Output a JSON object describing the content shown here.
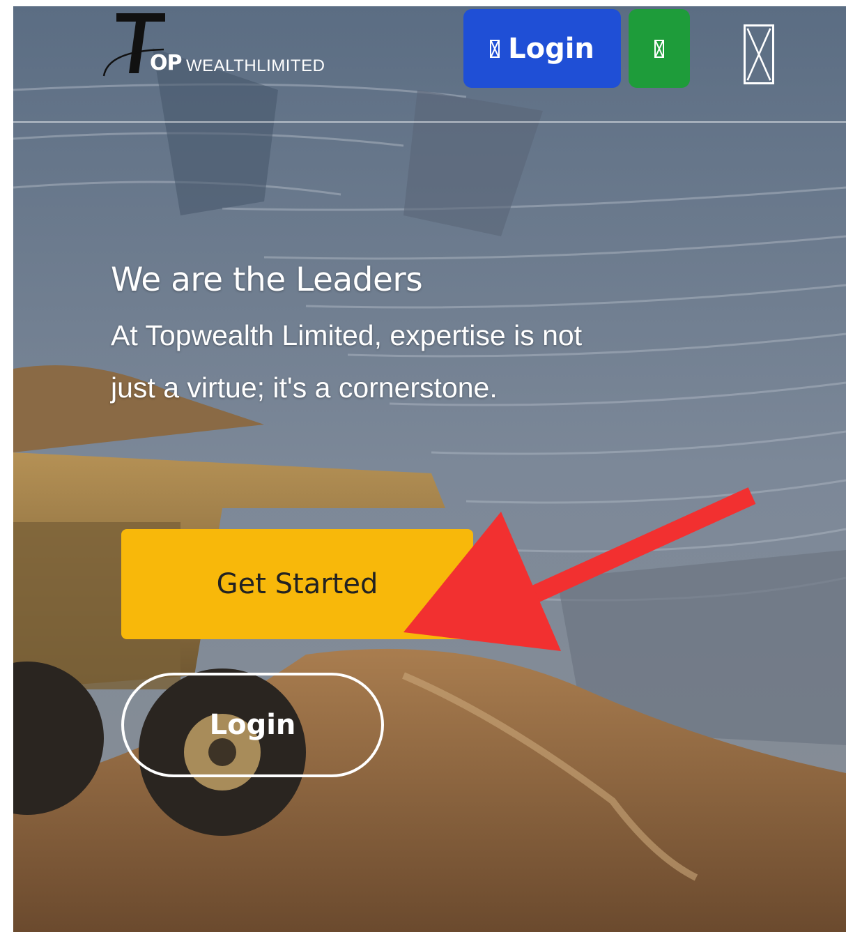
{
  "header": {
    "logo": {
      "mark_letter": "T",
      "op_text": "OP",
      "wealth_text": "WEALTHLIMITED"
    },
    "login_button_label": "Login",
    "login_button_icon": "missing-glyph-icon",
    "green_button_icon": "missing-glyph-icon",
    "menu_icon": "missing-glyph-icon"
  },
  "hero": {
    "title": "We are the Leaders",
    "body": "At Topwealth Limited, expertise is not just a virtue; it's a cornerstone.",
    "get_started_label": "Get Started",
    "login_label": "Login"
  },
  "colors": {
    "login_button": "#1f4fd6",
    "green_button": "#1e9c3a",
    "get_started": "#f8b80a",
    "annotation_arrow": "#f23030"
  }
}
